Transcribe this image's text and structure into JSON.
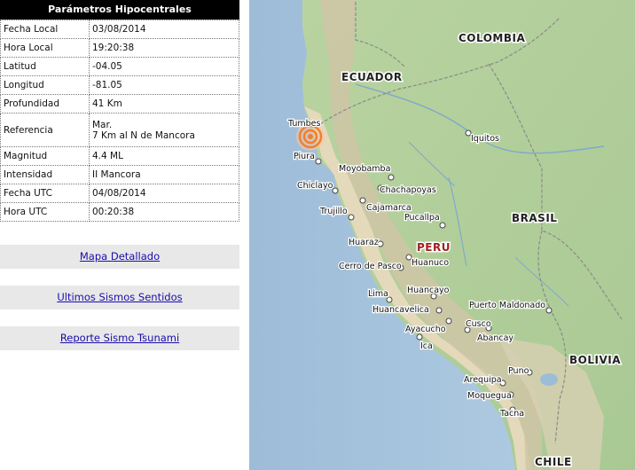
{
  "panel": {
    "title": "Parámetros Hipocentrales",
    "rows": [
      {
        "key": "Fecha Local",
        "value": "03/08/2014"
      },
      {
        "key": "Hora Local",
        "value": "19:20:38"
      },
      {
        "key": "Latitud",
        "value": "-04.05"
      },
      {
        "key": "Longitud",
        "value": "-81.05"
      },
      {
        "key": "Profundidad",
        "value": "41 Km"
      },
      {
        "key": "Referencia",
        "value": "Mar.",
        "value2": "7 Km al N de Mancora"
      },
      {
        "key": "Magnitud",
        "value": "4.4 ML"
      },
      {
        "key": "Intensidad",
        "value": "II Mancora"
      },
      {
        "key": "Fecha UTC",
        "value": "04/08/2014"
      },
      {
        "key": "Hora UTC",
        "value": "00:20:38"
      }
    ]
  },
  "links": {
    "map": "Mapa Detallado",
    "recent": "Ultimos Sismos Sentidos",
    "tsunami": "Reporte Sismo Tsunami"
  },
  "map": {
    "countries": {
      "colombia": "COLOMBIA",
      "ecuador": "ECUADOR",
      "brasil": "BRASIL",
      "peru": "PERU",
      "bolivia": "BOLIVIA",
      "chile": "CHILE"
    },
    "cities": {
      "tumbes": "Tumbes",
      "piura": "Piura",
      "chiclayo": "Chiclayo",
      "trujillo": "Trujillo",
      "moyobamba": "Moyobamba",
      "chachapoyas": "Chachapoyas",
      "cajamarca": "Cajamarca",
      "pucallpa": "Pucallpa",
      "iquitos": "Iquitos",
      "huaraz": "Huaraz",
      "cerro": "Cerro de Pasco",
      "huanuco": "Huanuco",
      "lima": "Lima",
      "huancayo": "Huancayo",
      "huancavelica": "Huancavelica",
      "ayacucho": "Ayacucho",
      "ica": "Ica",
      "puerto": "Puerto Maldonado",
      "cusco": "Cusco",
      "abancay": "Abancay",
      "puno": "Puno",
      "arequipa": "Arequipa",
      "moquegua": "Moquegua",
      "tacna": "Tacna"
    },
    "colors": {
      "ocean": "#a9c6de",
      "land": "#bcd3a4",
      "desert": "#e6dcc0",
      "epicenter": "#f08030"
    }
  }
}
